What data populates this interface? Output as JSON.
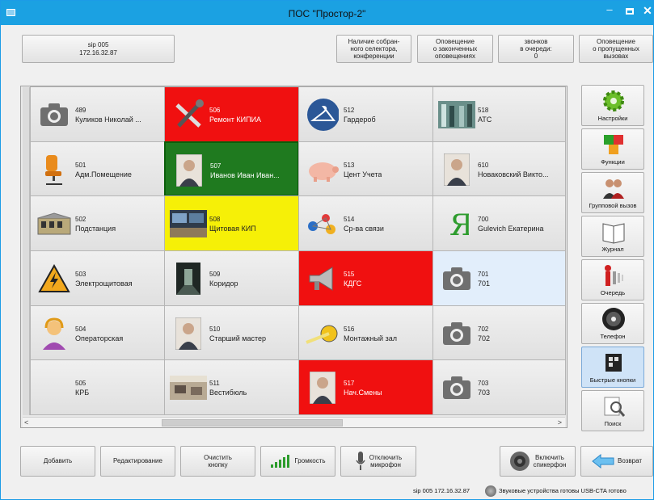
{
  "window": {
    "title": "ПОС \"Простор-2\""
  },
  "header": {
    "sip_line1": "sip 005",
    "sip_line2": "172.16.32.87",
    "btn_conf": "Наличие собран-\nного селектора,\nконференции",
    "btn_alerts": "Оповещение\nо законченных\nоповещениях",
    "btn_queue": "звонков\nв очереди:\n0",
    "btn_missed": "Оповещение\nо пропущенных\nвызовах"
  },
  "grid": {
    "cells": [
      {
        "num": "489",
        "name": "Куликов Николай ...",
        "icon": "camera-icon",
        "state": "normal"
      },
      {
        "num": "506",
        "name": "Ремонт КИПИА",
        "icon": "tools-icon",
        "state": "red"
      },
      {
        "num": "512",
        "name": "Гардероб",
        "icon": "hanger-icon",
        "state": "normal"
      },
      {
        "num": "518",
        "name": "АТС",
        "icon": "server-room-photo",
        "state": "normal"
      },
      {
        "num": "501",
        "name": "Адм.Помещение",
        "icon": "office-chair-icon",
        "state": "normal"
      },
      {
        "num": "507",
        "name": "Иванов Иван Иван...",
        "icon": "person-photo",
        "state": "green"
      },
      {
        "num": "513",
        "name": "Цент Учета",
        "icon": "piggy-bank-icon",
        "state": "normal"
      },
      {
        "num": "610",
        "name": "Новаковский Викто...",
        "icon": "person-photo",
        "state": "normal"
      },
      {
        "num": "502",
        "name": "Подстанция",
        "icon": "substation-icon",
        "state": "normal"
      },
      {
        "num": "508",
        "name": "Щитовая КИП",
        "icon": "control-room-photo",
        "state": "yellow"
      },
      {
        "num": "514",
        "name": "Ср-ва связи",
        "icon": "network-icon",
        "state": "normal"
      },
      {
        "num": "700",
        "name": "Gulevich Екатерина",
        "icon": "yandex-logo-icon",
        "state": "normal"
      },
      {
        "num": "503",
        "name": "Электрощитовая",
        "icon": "warning-icon",
        "state": "normal"
      },
      {
        "num": "509",
        "name": "Коридор",
        "icon": "corridor-photo",
        "state": "normal"
      },
      {
        "num": "515",
        "name": "КДГС",
        "icon": "speaker-horn-icon",
        "state": "red"
      },
      {
        "num": "701",
        "name": "701",
        "icon": "camera-icon",
        "state": "blue"
      },
      {
        "num": "504",
        "name": "Операторская",
        "icon": "operator-icon",
        "state": "normal"
      },
      {
        "num": "510",
        "name": "Старший мастер",
        "icon": "person-photo",
        "state": "normal"
      },
      {
        "num": "516",
        "name": "Монтажный зал",
        "icon": "tape-measure-icon",
        "state": "normal"
      },
      {
        "num": "702",
        "name": "702",
        "icon": "camera-icon",
        "state": "normal"
      },
      {
        "num": "505",
        "name": "КРБ",
        "icon": "",
        "state": "normal"
      },
      {
        "num": "511",
        "name": "Вестибюль",
        "icon": "lobby-photo",
        "state": "normal"
      },
      {
        "num": "517",
        "name": "Нач.Смены",
        "icon": "person-photo",
        "state": "red"
      },
      {
        "num": "703",
        "name": "703",
        "icon": "camera-icon",
        "state": "normal"
      }
    ]
  },
  "scroll": {
    "left": "<",
    "right": ">"
  },
  "sidebar": {
    "items": [
      {
        "label": "Настройки",
        "icon": "gear-icon"
      },
      {
        "label": "Функции",
        "icon": "functions-icon"
      },
      {
        "label": "Групповой вызов",
        "icon": "group-call-icon"
      },
      {
        "label": "Журнал",
        "icon": "journal-icon"
      },
      {
        "label": "Очередь",
        "icon": "queue-icon"
      },
      {
        "label": "Телефон",
        "icon": "phone-dial-icon"
      },
      {
        "label": "Быстрые кнопки",
        "icon": "quick-buttons-icon"
      },
      {
        "label": "Поиск",
        "icon": "search-icon"
      }
    ]
  },
  "bottom": {
    "add": "Добавить",
    "edit": "Редактирование",
    "clear": "Очистить\nкнопку",
    "volume": "Громкость",
    "mute_mic": "Отключить\nмикрофон",
    "speaker": "Включить\nспикерфон",
    "back": "Возврат"
  },
  "status": {
    "sip": "sip 005 172.16.32.87",
    "sound": "Звуковые устройства готовы USB-CTA готово"
  },
  "colors": {
    "titlebar": "#1ba1e2",
    "red": "#f01010",
    "green": "#1f7a1f",
    "yellow": "#f6f007",
    "blue": "#e2eefb"
  }
}
